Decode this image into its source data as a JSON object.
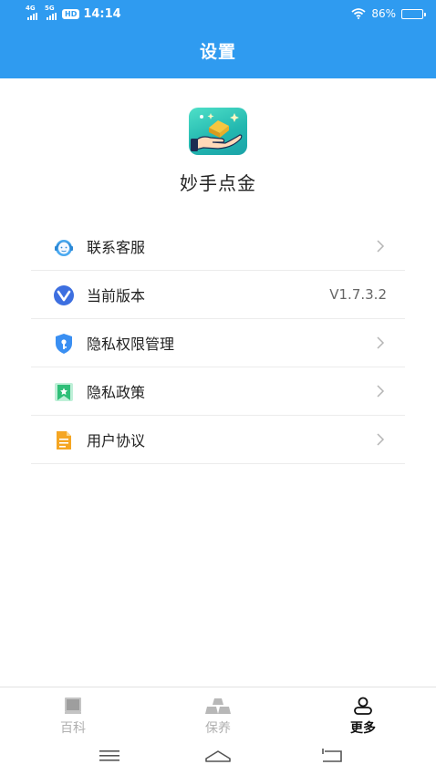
{
  "status_bar": {
    "signal1_label": "4G",
    "signal2_label": "5G",
    "hd_label": "HD",
    "time": "14:14",
    "battery": "86%",
    "battery_level": 0.86
  },
  "header": {
    "title": "设置"
  },
  "app": {
    "name": "妙手点金",
    "logo_icon": "gold-hand-logo-icon"
  },
  "menu": [
    {
      "label": "联系客服",
      "icon": "customer-service-icon",
      "trailing": "chevron"
    },
    {
      "label": "当前版本",
      "icon": "version-icon",
      "trailing": "value",
      "value": "V1.7.3.2"
    },
    {
      "label": "隐私权限管理",
      "icon": "shield-icon",
      "trailing": "chevron"
    },
    {
      "label": "隐私政策",
      "icon": "bookmark-star-icon",
      "trailing": "chevron"
    },
    {
      "label": "用户协议",
      "icon": "document-icon",
      "trailing": "chevron"
    }
  ],
  "tabs": [
    {
      "label": "百科",
      "icon": "book-icon",
      "active": false
    },
    {
      "label": "保养",
      "icon": "gold-bars-icon",
      "active": false
    },
    {
      "label": "更多",
      "icon": "user-icon",
      "active": true
    }
  ],
  "nav": [
    "menu-icon",
    "home-icon",
    "back-icon"
  ],
  "colors": {
    "header_bg": "#2f9bf0",
    "text_primary": "#222222",
    "tab_inactive": "#b0b0b0",
    "tab_active": "#111111"
  }
}
